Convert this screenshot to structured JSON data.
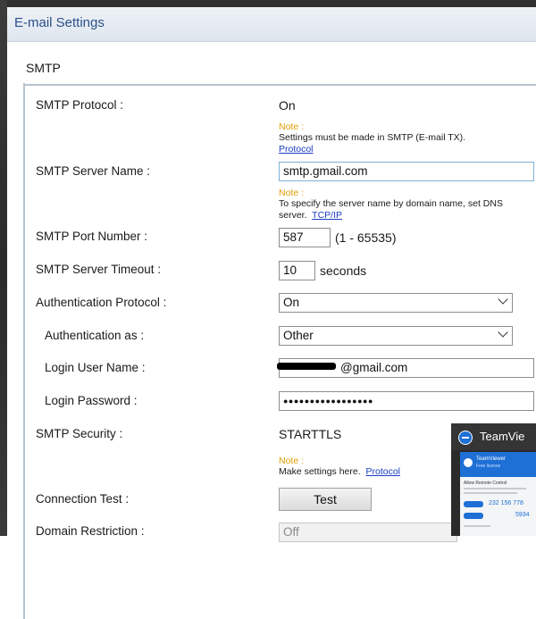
{
  "window": {
    "title": "E-mail Settings"
  },
  "section": {
    "title": "SMTP"
  },
  "smtp_protocol": {
    "label": "SMTP Protocol :",
    "value": "On",
    "note_head": "Note :",
    "note_text": "Settings must be made in SMTP (E-mail TX).",
    "note_link": "Protocol"
  },
  "smtp_server_name": {
    "label": "SMTP Server Name :",
    "value": "smtp.gmail.com",
    "note_head": "Note :",
    "note_text": "To specify the server name by domain name, set DNS server.",
    "note_link": "TCP/IP"
  },
  "smtp_port_number": {
    "label": "SMTP Port Number :",
    "value": "587",
    "range": "(1 - 65535)"
  },
  "smtp_server_timeout": {
    "label": "SMTP Server Timeout :",
    "value": "10",
    "unit": "seconds"
  },
  "authentication_protocol": {
    "label": "Authentication Protocol :",
    "selected": "On"
  },
  "authentication_as": {
    "label": "Authentication as :",
    "selected": "Other"
  },
  "login_user_name": {
    "label": "Login User Name :",
    "value_suffix": "@gmail.com"
  },
  "login_password": {
    "label": "Login Password :",
    "value": "●●●●●●●●●●●●●●●●●"
  },
  "smtp_security": {
    "label": "SMTP Security :",
    "value": "STARTTLS",
    "note_head": "Note :",
    "note_text": "Make settings here.",
    "note_link": "Protocol"
  },
  "connection_test": {
    "label": "Connection Test :",
    "button_label": "Test"
  },
  "domain_restriction": {
    "label": "Domain Restriction :",
    "selected": "Off"
  },
  "teamviewer_popup": {
    "title": "TeamVie",
    "panel_name": "TeamViewer",
    "panel_sub": "Free license",
    "line1": "Allow Remote Control",
    "id_value": "232 156 778",
    "pw_value": "5934"
  },
  "colors": {
    "note_orange": "#e0a000",
    "link_blue": "#1a3dc4",
    "title_blue": "#2a4f8a",
    "teamviewer_blue": "#1e6fd6"
  }
}
